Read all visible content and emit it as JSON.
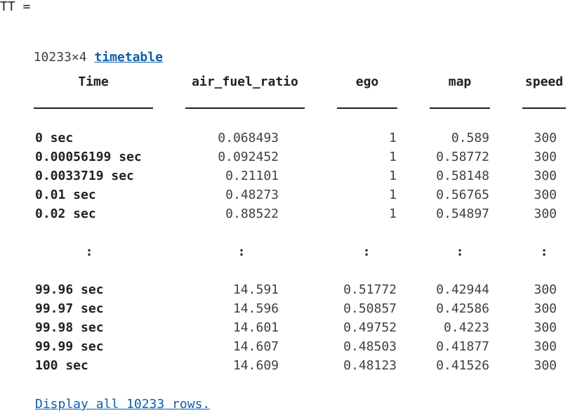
{
  "variable_line": "TT =",
  "size_text": "10233×4",
  "type_link": "timetable",
  "columns": [
    "Time",
    "air_fuel_ratio",
    "ego",
    "map",
    "speed"
  ],
  "ellipsis": ":",
  "top_rows": [
    [
      "0 sec",
      "0.068493",
      "1",
      "0.589",
      "300"
    ],
    [
      "0.00056199 sec",
      "0.092452",
      "1",
      "0.58772",
      "300"
    ],
    [
      "0.0033719 sec",
      "0.21101",
      "1",
      "0.58148",
      "300"
    ],
    [
      "0.01 sec",
      "0.48273",
      "1",
      "0.56765",
      "300"
    ],
    [
      "0.02 sec",
      "0.88522",
      "1",
      "0.54897",
      "300"
    ]
  ],
  "bottom_rows": [
    [
      "99.96 sec",
      "14.591",
      "0.51772",
      "0.42944",
      "300"
    ],
    [
      "99.97 sec",
      "14.596",
      "0.50857",
      "0.42586",
      "300"
    ],
    [
      "99.98 sec",
      "14.601",
      "0.49752",
      "0.4223",
      "300"
    ],
    [
      "99.99 sec",
      "14.607",
      "0.48503",
      "0.41877",
      "300"
    ],
    [
      "100 sec",
      "14.609",
      "0.48123",
      "0.41526",
      "300"
    ]
  ],
  "display_all_link": "Display all 10233 rows."
}
